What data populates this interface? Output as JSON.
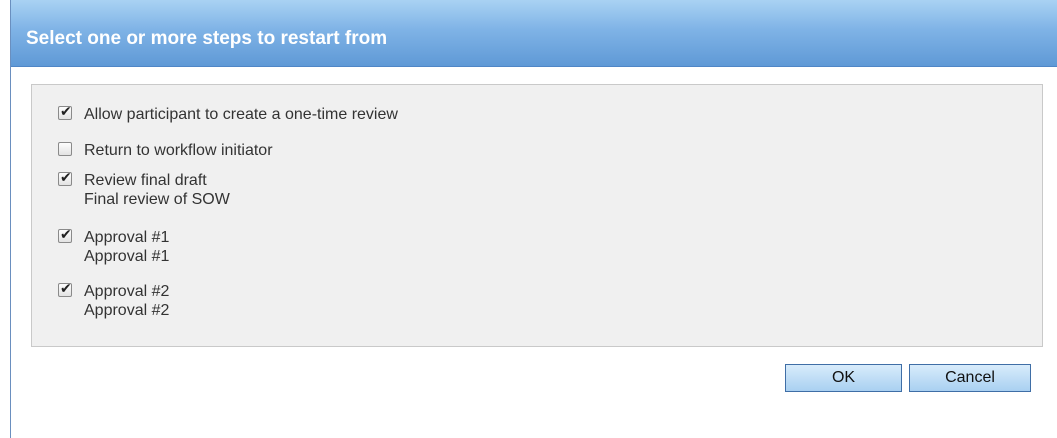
{
  "dialog": {
    "title": "Select one or more steps to restart from"
  },
  "steps": [
    {
      "label": "Allow participant to create a one-time review",
      "description": "",
      "checked": true
    },
    {
      "label": "Return to workflow initiator",
      "description": "",
      "checked": false
    },
    {
      "label": "Review final draft",
      "description": "Final review of SOW",
      "checked": true
    },
    {
      "label": "Approval #1",
      "description": "Approval #1",
      "checked": true
    },
    {
      "label": "Approval #2",
      "description": "Approval #2",
      "checked": true
    }
  ],
  "buttons": {
    "ok_label": "OK",
    "cancel_label": "Cancel"
  },
  "icons": {
    "checkmark": "checkmark-icon"
  },
  "colors": {
    "title_bar": "#7fb3e6",
    "panel_bg": "#f0f0f0",
    "button_bg": "#a9d0f1"
  }
}
